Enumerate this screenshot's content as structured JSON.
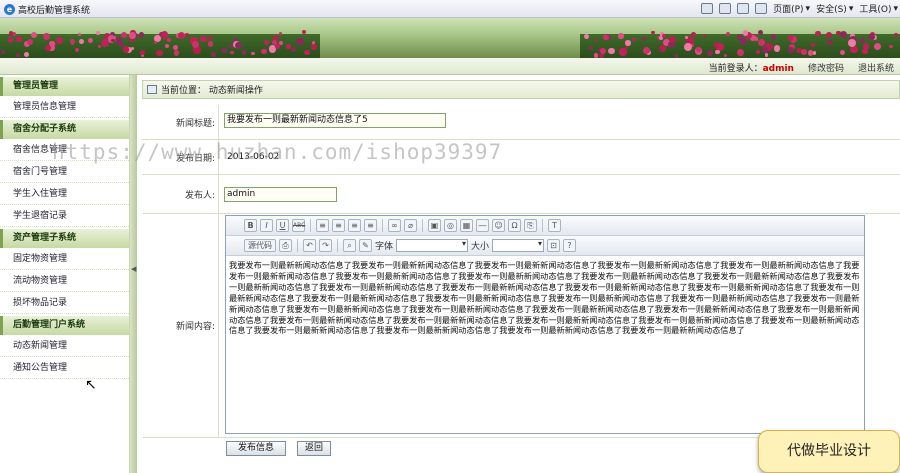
{
  "browser": {
    "title": "高校后勤管理系统",
    "toolbar": [
      "页面(P)",
      "安全(S)",
      "工具(O)"
    ]
  },
  "userbar": {
    "current_user_label": "当前登录人：",
    "current_user": "admin",
    "change_password": "修改密码",
    "logout": "退出系统"
  },
  "sidebar": {
    "groups": [
      {
        "title": "管理员管理",
        "items": [
          "管理员信息管理"
        ]
      },
      {
        "title": "宿舍分配子系统",
        "items": [
          "宿舍信息管理",
          "宿舍门号管理",
          "学生入住管理",
          "学生退宿记录"
        ]
      },
      {
        "title": "资产管理子系统",
        "items": [
          "固定物资管理",
          "流动物资管理",
          "损坏物品记录"
        ]
      },
      {
        "title": "后勤管理门户系统",
        "items": [
          "动态新闻管理",
          "通知公告管理"
        ]
      }
    ]
  },
  "breadcrumb": "当前位置：  动态新闻操作",
  "form": {
    "title_label": "新闻标题:",
    "title_value": "我要发布一则最新新闻动态信息了5",
    "date_label": "发布日期:",
    "date_value": "2013-06-02",
    "publisher_label": "发布人:",
    "publisher_value": "admin",
    "content_label": "新闻内容:",
    "content_value": "我要发布一则最新新闻动态信息了我要发布一则最新新闻动态信息了我要发布一则最新新闻动态信息了我要发布一则最新新闻动态信息了我要发布一则最新新闻动态信息了我要发布一则最新新闻动态信息了我要发布一则最新新闻动态信息了我要发布一则最新新闻动态信息了我要发布一则最新新闻动态信息了我要发布一则最新新闻动态信息了我要发布一则最新新闻动态信息了我要发布一则最新新闻动态信息了我要发布一则最新新闻动态信息了我要发布一则最新新闻动态信息了我要发布一则最新新闻动态信息了我要发布一则最新新闻动态信息了我要发布一则最新新闻动态信息了我要发布一则最新新闻动态信息了我要发布一则最新新闻动态信息了我要发布一则最新新闻动态信息了我要发布一则最新新闻动态信息了我要发布一则最新新闻动态信息了我要发布一则最新新闻动态信息了我要发布一则最新新闻动态信息了我要发布一则最新新闻动态信息了我要发布一则最新新闻动态信息了我要发布一则最新新闻动态信息了我要发布一则最新新闻动态信息了我要发布一则最新新闻动态信息了我要发布一则最新新闻动态信息了我要发布一则最新新闻动态信息了我要发布一则最新新闻动态信息了我要发布一则最新新闻动态信息了我要发布一则最新新闻动态信息了我要发布一则最新新闻动态信息了"
  },
  "editor": {
    "source_button": "源代码",
    "font_label": "字体",
    "size_label": "大小",
    "bold": "B",
    "italic": "I",
    "underline": "U",
    "strike": "ABC"
  },
  "buttons": {
    "submit": "发布信息",
    "back": "返回"
  },
  "watermark": "https://www.huzhan.com/ishop39397",
  "badge": "代做毕业设计",
  "colors": {
    "accent_green": "#7ea34e",
    "user_name": "#cc0000",
    "badge_bg": "#fff2b8"
  }
}
